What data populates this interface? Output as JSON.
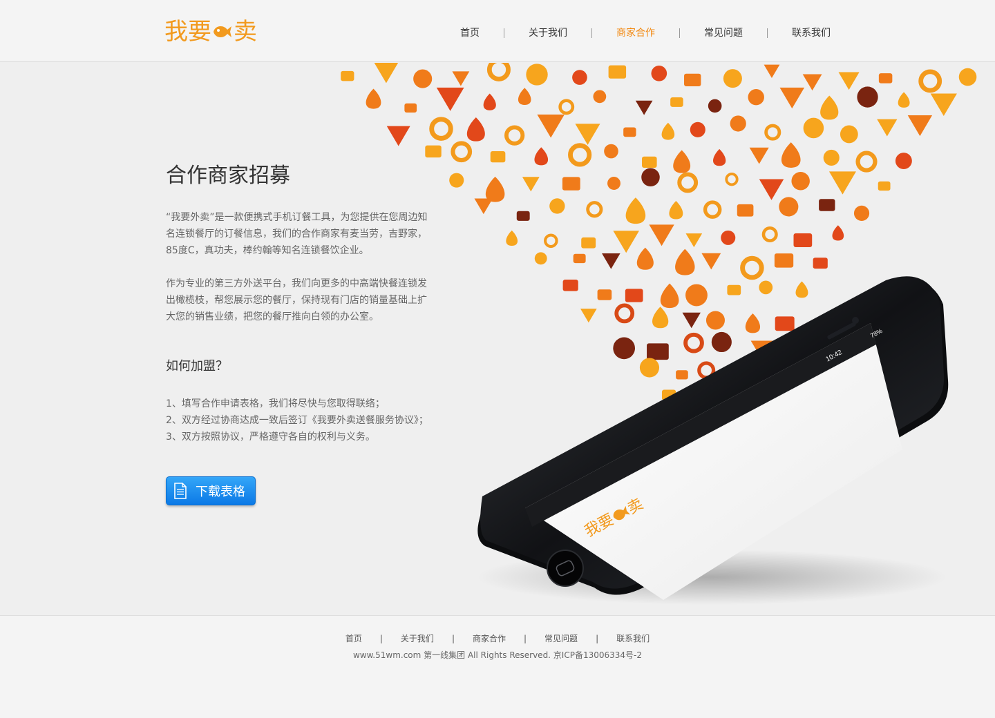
{
  "brand": {
    "logo_left": "我要",
    "logo_right": "卖",
    "accent": "#f29a1e"
  },
  "nav": {
    "items": [
      {
        "label": "首页"
      },
      {
        "label": "关于我们"
      },
      {
        "label": "商家合作",
        "active": true
      },
      {
        "label": "常见问题"
      },
      {
        "label": "联系我们"
      }
    ]
  },
  "main": {
    "title": "合作商家招募",
    "para1": "“我要外卖”是一款便携式手机订餐工具，为您提供在您周边知名连锁餐厅的订餐信息，我们的合作商家有麦当劳，吉野家，85度C，真功夫，棒约翰等知名连锁餐饮企业。",
    "para2": "作为专业的第三方外送平台，我们向更多的中高端快餐连锁发出橄榄枝，帮您展示您的餐厅，保持现有门店的销量基础上扩大您的销售业绩，把您的餐厅推向白领的办公室。",
    "subtitle": "如何加盟？",
    "steps": [
      "1、填写合作申请表格，我们将尽快与您取得联络；",
      "2、双方经过协商达成一致后签订《我要外卖送餐服务协议》；",
      "3、双方按照协议，严格遵守各自的权利与义务。"
    ],
    "download_label": "下载表格",
    "download_icon": "document-icon"
  },
  "phone": {
    "time": "10:42",
    "battery": "78%",
    "screen_logo_left": "我要",
    "screen_logo_right": "卖"
  },
  "footer": {
    "nav": [
      "首页",
      "关于我们",
      "商家合作",
      "常见问题",
      "联系我们"
    ],
    "copyright": "www.51wm.com 第一线集团 All Rights Reserved. 京ICP备13006334号-2"
  }
}
